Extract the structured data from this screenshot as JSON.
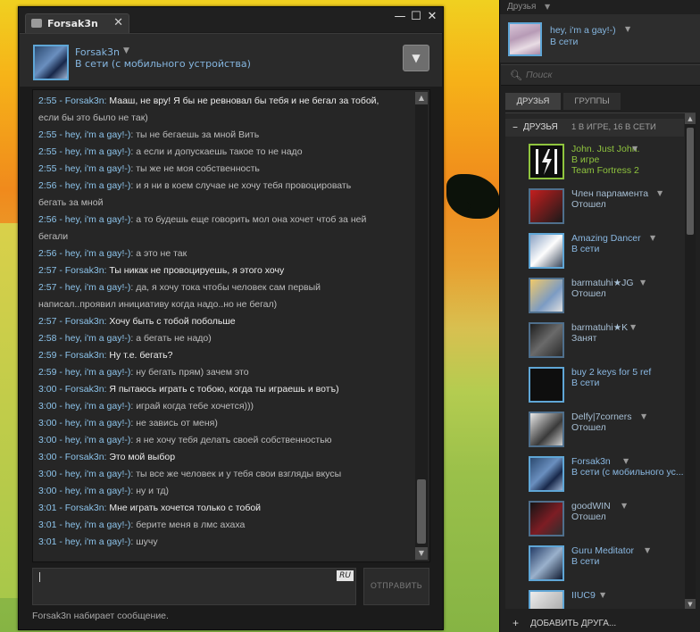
{
  "chat_window": {
    "tab_label": "Forsak3n",
    "tab_close": "✕",
    "minimize": "—",
    "maximize": "☐",
    "close": "✕",
    "friend_name": "Forsak3n",
    "friend_status": "В сети (с мобильного устройства)",
    "dropdown_glyph": "▼",
    "language_badge": "RU",
    "send_label": "ОТПРАВИТЬ",
    "typing_status": "Forsak3n набирает сообщение.",
    "messages": [
      {
        "ts": "2:55 - Forsak3n:",
        "text": "Мааш, не вру! Я бы не ревновал бы тебя и не бегал за тобой,"
      },
      {
        "ts": "",
        "text": "если бы это было не так)"
      },
      {
        "ts": "2:55 - hey, i'm a gay!-)",
        "text": ": ты не бегаешь за мной Вить"
      },
      {
        "ts": "2:55 - hey, i'm a gay!-)",
        "text": ": а если и допускаешь такое то не надо"
      },
      {
        "ts": "2:55 - hey, i'm a gay!-)",
        "text": ": ты же не моя собственность"
      },
      {
        "ts": "2:56 - hey, i'm a gay!-)",
        "text": ": и я ни в коем случае не хочу тебя провоцировать"
      },
      {
        "ts": "",
        "text": "бегать за мной"
      },
      {
        "ts": "2:56 - hey, i'm a gay!-)",
        "text": ": а то будешь еще говорить мол она хочет чтоб за ней"
      },
      {
        "ts": "",
        "text": "бегали"
      },
      {
        "ts": "2:56 - hey, i'm a gay!-)",
        "text": ": а это не так"
      },
      {
        "ts": "2:57 - Forsak3n:",
        "text": "Ты никак не провоцируешь, я этого хочу"
      },
      {
        "ts": "2:57 - hey, i'm a gay!-)",
        "text": ": да, я хочу тока чтобы человек сам первый"
      },
      {
        "ts": "",
        "text": "написал..проявил инициативу когда надо..но не бегал)"
      },
      {
        "ts": "2:57 - Forsak3n:",
        "text": "Хочу быть с тобой побольше"
      },
      {
        "ts": "2:58 - hey, i'm a gay!-)",
        "text": ": а бегать не надо)"
      },
      {
        "ts": "2:59 - Forsak3n:",
        "text": "Ну т.е. бегать?"
      },
      {
        "ts": "2:59 - hey, i'm a gay!-)",
        "text": ": ну бегать прям) зачем это"
      },
      {
        "ts": "3:00 - Forsak3n:",
        "text": "Я пытаюсь играть с тобою, когда ты играешь и вотъ)"
      },
      {
        "ts": "3:00 - hey, i'm a gay!-)",
        "text": ": играй когда тебе хочется)))"
      },
      {
        "ts": "3:00 - hey, i'm a gay!-)",
        "text": ": не завись от меня)"
      },
      {
        "ts": "3:00 - hey, i'm a gay!-)",
        "text": ": я не хочу тебя делать своей собственностью"
      },
      {
        "ts": "3:00 - Forsak3n:",
        "text": "Это мой выбор"
      },
      {
        "ts": "3:00 - hey, i'm a gay!-)",
        "text": ": ты все же человек и у тебя свои взгляды вкусы"
      },
      {
        "ts": "3:00 - hey, i'm a gay!-)",
        "text": ": ну и тд)"
      },
      {
        "ts": "3:01 - Forsak3n:",
        "text": "Мне играть хочется только с тобой"
      },
      {
        "ts": "3:01 - hey, i'm a gay!-)",
        "text": ": берите меня в лмс ахаха"
      },
      {
        "ts": "3:01 - hey, i'm a gay!-)",
        "text": ": шучу"
      }
    ]
  },
  "friends_panel": {
    "title": "Друзья",
    "self_name": "hey, i'm a gay!-)",
    "self_status": "В сети",
    "search_placeholder": "Поиск",
    "tab_friends": "ДРУЗЬЯ",
    "tab_groups": "ГРУППЫ",
    "section_title": "ДРУЗЬЯ",
    "section_count": "1 В ИГРЕ, 16 В СЕТИ",
    "add_friend": "ДОБАВИТЬ ДРУГА...",
    "friends": [
      {
        "name": "John. Just John.",
        "status": "В игре",
        "game": "Team Fortress 2",
        "state": "ingame"
      },
      {
        "name": "Член парламента",
        "status": "Отошел",
        "game": "",
        "state": "off"
      },
      {
        "name": "Amazing Dancer",
        "status": "В сети",
        "game": "",
        "state": "online"
      },
      {
        "name": "barmatuhi★JG",
        "status": "Отошел",
        "game": "",
        "state": "off"
      },
      {
        "name": "barmatuhi★K",
        "status": "Занят",
        "game": "",
        "state": "off"
      },
      {
        "name": "buy 2 keys for 5 ref",
        "status": "В сети",
        "game": "",
        "state": "online"
      },
      {
        "name": "Delfy|7corners",
        "status": "Отошел",
        "game": "",
        "state": "off"
      },
      {
        "name": "Forsak3n",
        "status": "В сети (с мобильного ус...",
        "game": "",
        "state": "online"
      },
      {
        "name": "goodWIN",
        "status": "Отошел",
        "game": "",
        "state": "off"
      },
      {
        "name": "Guru Meditator",
        "status": "В сети",
        "game": "",
        "state": "online"
      },
      {
        "name": "IIUC9",
        "status": "",
        "game": "",
        "state": "online"
      }
    ]
  },
  "colors": {
    "accent_online": "#8ab8e2",
    "accent_ingame": "#8fc43e",
    "panel_bg": "#202020"
  }
}
